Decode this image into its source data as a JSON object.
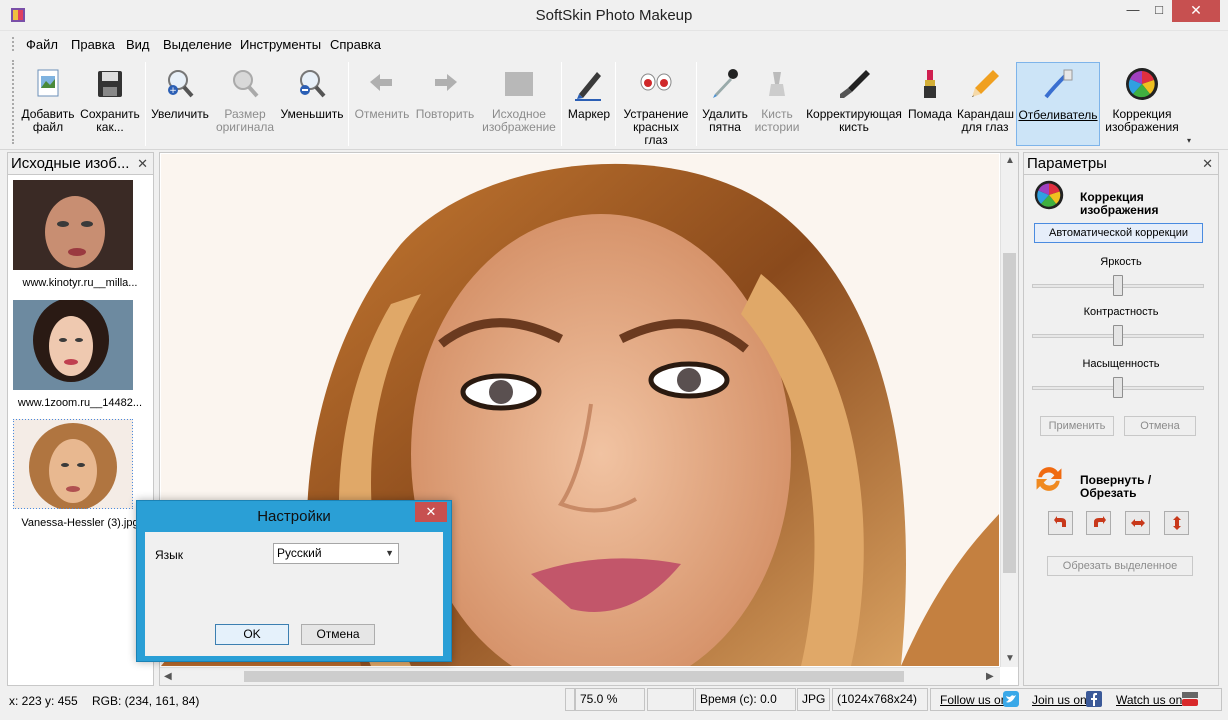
{
  "window": {
    "title": "SoftSkin Photo Makeup",
    "minimize": "—",
    "maximize": "□",
    "close": "✕"
  },
  "menu": [
    "Файл",
    "Правка",
    "Вид",
    "Выделение",
    "Инструменты",
    "Справка"
  ],
  "toolbar": {
    "add_file": "Добавить файл",
    "save_as": "Сохранить как...",
    "zoom_in": "Увеличить",
    "original_size": "Размер оригинала",
    "zoom_out": "Уменьшить",
    "undo": "Отменить",
    "redo": "Повторить",
    "source_image": "Исходное изображение",
    "marker": "Маркер",
    "red_eye": "Устранение красных глаз",
    "remove_spots": "Удалить пятна",
    "history_brush": "Кисть истории",
    "correcting_brush": "Корректирующая кисть",
    "lipstick": "Помада",
    "eye_pencil": "Карандаш для глаз",
    "whitener": "Отбеливатель",
    "image_correction": "Коррекция изображения",
    "more": "▾"
  },
  "left_panel": {
    "title": "Исходные изоб...",
    "close": "✕",
    "thumbnails": [
      {
        "label": "www.kinotyr.ru__milla..."
      },
      {
        "label": "www.1zoom.ru__14482..."
      },
      {
        "label": "Vanessa-Hessler (3).jpg"
      }
    ]
  },
  "right_panel": {
    "title": "Параметры",
    "close": "✕",
    "correction_title": "Коррекция изображения",
    "auto_button": "Автоматической коррекции",
    "brightness_label": "Яркость",
    "contrast_label": "Контрастность",
    "saturation_label": "Насыщенность",
    "brightness": 0.5,
    "contrast": 0.5,
    "saturation": 0.5,
    "apply": "Применить",
    "cancel": "Отмена",
    "rotate_title": "Повернуть / Обрезать",
    "crop_button": "Обрезать выделенное"
  },
  "statusbar": {
    "coords": "x: 223 y: 455",
    "rgb": "RGB: (234, 161, 84)",
    "zoom": "75.0 %",
    "time": "Время (с): 0.0",
    "format": "JPG",
    "dimensions": "(1024x768x24)",
    "follow_us": "Follow us on",
    "join_us": "Join us on",
    "watch_us": "Watch us on"
  },
  "dialog": {
    "title": "Настройки",
    "close": "✕",
    "language_label": "Язык",
    "language_value": "Русский",
    "ok": "OK",
    "cancel": "Отмена"
  },
  "colors": {
    "accent": "#2a9fd6",
    "close_red": "#c75050",
    "active_button": "#cce4f7"
  }
}
